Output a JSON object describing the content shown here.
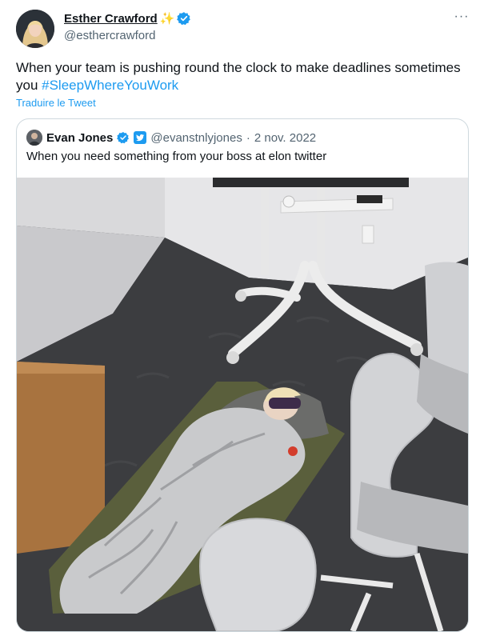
{
  "tweet": {
    "author_name": "Esther Crawford",
    "sparkle": "✨",
    "handle": "@esthercrawford",
    "more": "···",
    "text_before": "When your team is pushing round the clock to make deadlines sometimes you ",
    "hashtag": "#SleepWhereYouWork",
    "translate_label": "Traduire le Tweet"
  },
  "quote": {
    "author_name": "Evan Jones",
    "handle": "@evanstnlyjones",
    "separator": "·",
    "date": "2 nov. 2022",
    "text": "When you need something from your boss at elon twitter"
  },
  "colors": {
    "accent": "#1d9bf0",
    "text": "#0f1419",
    "secondary": "#536471",
    "border": "#cfd9de"
  },
  "icons": {
    "verified": "verified-badge-icon",
    "more": "more-options-icon",
    "affiliation": "twitter-affiliation-icon"
  }
}
